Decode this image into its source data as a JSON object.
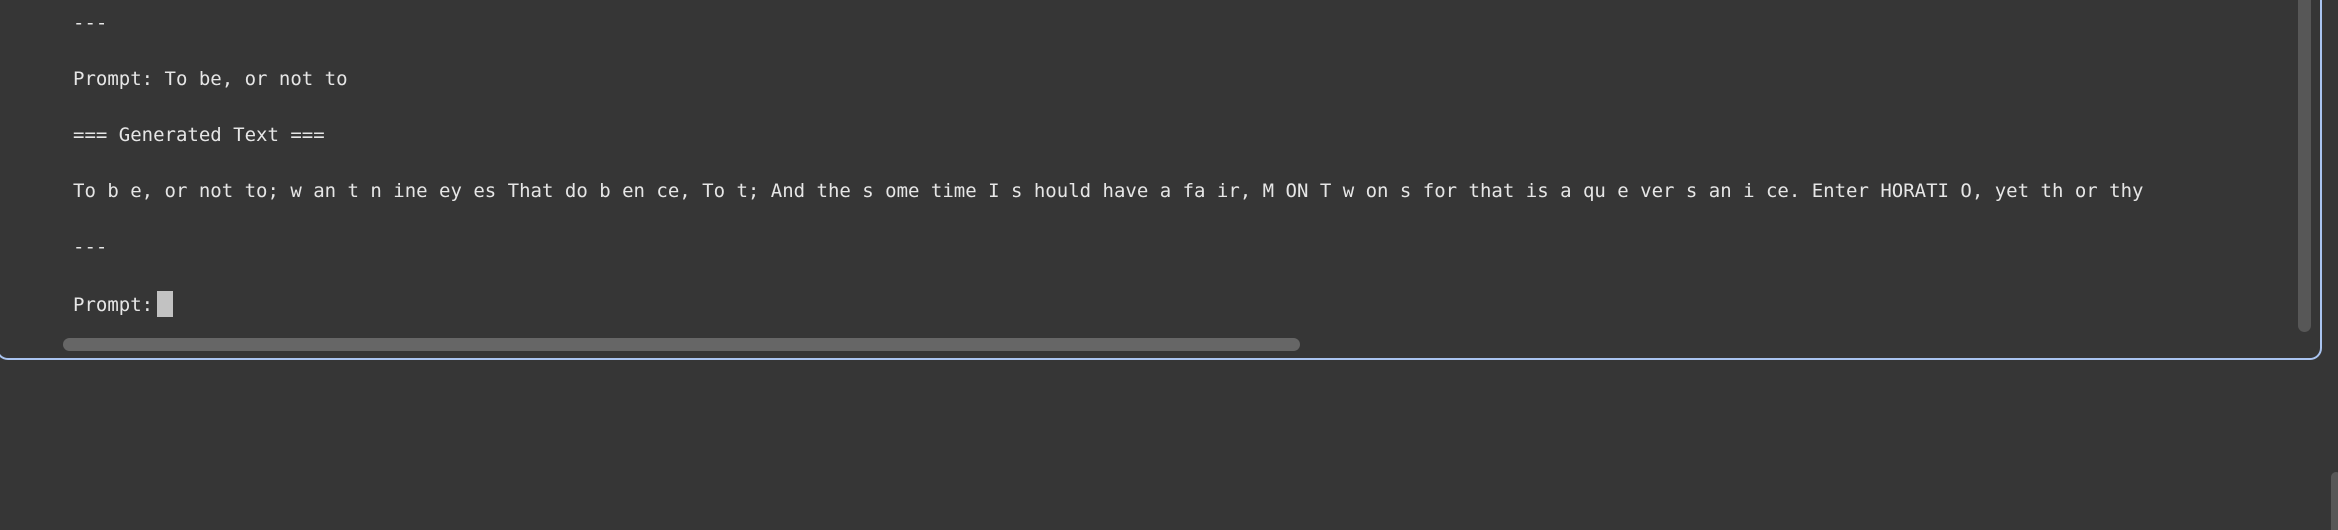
{
  "terminal": {
    "lines": [
      "---",
      "Prompt: To be, or not to",
      "=== Generated Text ===",
      "To b e, or not to; w an t n ine ey es That do b en ce, To t; And the s ome time I s hould have a fa ir, M ON T w on s for that is a qu e ver s an i ce. Enter HORATI O, yet th or thy",
      "---",
      "Prompt:"
    ],
    "input_value": ""
  }
}
